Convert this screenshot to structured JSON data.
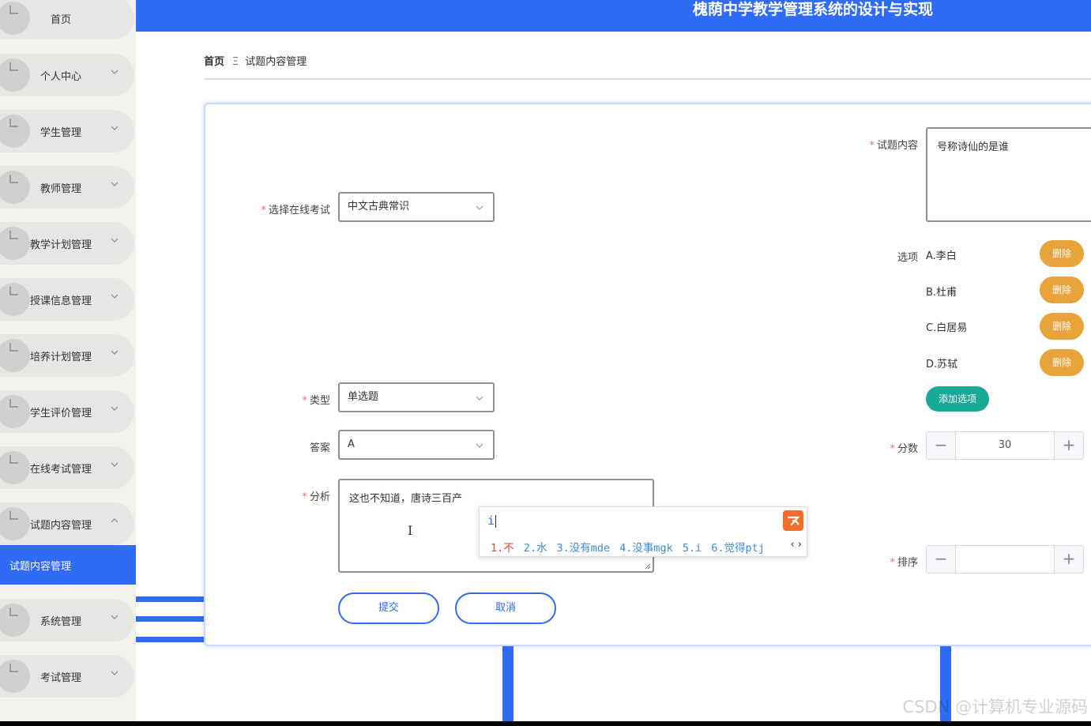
{
  "app": {
    "title": "槐荫中学教学管理系统的设计与实现"
  },
  "sidebar": {
    "items": [
      {
        "label": "首页",
        "has_chevron": false
      },
      {
        "label": "个人中心",
        "has_chevron": true
      },
      {
        "label": "学生管理",
        "has_chevron": true
      },
      {
        "label": "教师管理",
        "has_chevron": true
      },
      {
        "label": "教学计划管理",
        "has_chevron": true
      },
      {
        "label": "授课信息管理",
        "has_chevron": true
      },
      {
        "label": "培养计划管理",
        "has_chevron": true
      },
      {
        "label": "学生评价管理",
        "has_chevron": true
      },
      {
        "label": "在线考试管理",
        "has_chevron": true
      },
      {
        "label": "试题内容管理",
        "has_chevron": true,
        "expanded": true
      },
      {
        "label": "系统管理",
        "has_chevron": true
      },
      {
        "label": "考试管理",
        "has_chevron": true
      }
    ],
    "active_sub": "试题内容管理"
  },
  "breadcrumb": {
    "home": "首页",
    "separator": "Ξ",
    "current": "试题内容管理"
  },
  "form": {
    "exam_label": "选择在线考试",
    "exam_value": "中文古典常识",
    "type_label": "类型",
    "type_value": "单选题",
    "answer_label": "答案",
    "answer_value": "A",
    "analysis_label": "分析",
    "analysis_value": "这也不知道，唐诗三百产",
    "content_label": "试题内容",
    "content_value": "号称诗仙的是谁",
    "options_label": "选项",
    "options": [
      {
        "text": "A.李白",
        "delete_label": "删除"
      },
      {
        "text": "B.杜甫",
        "delete_label": "删除"
      },
      {
        "text": "C.白居易",
        "delete_label": "删除"
      },
      {
        "text": "D.苏轼",
        "delete_label": "删除"
      }
    ],
    "add_option_label": "添加选项",
    "score_label": "分数",
    "score_value": "30",
    "order_label": "排序",
    "order_value": "",
    "minus_symbol": "−",
    "plus_symbol": "+",
    "submit_label": "提交",
    "cancel_label": "取消"
  },
  "ime": {
    "composition": "i",
    "candidates": [
      "1.不",
      "2.水",
      "3.没有mde",
      "4.没事mgk",
      "5.i",
      "6.觉得ptj"
    ],
    "nav": "‹ ›"
  },
  "watermark": "CSDN @计算机专业源码",
  "colors": {
    "primary": "#2f6bf6",
    "delete": "#e9a33b",
    "add": "#19a996",
    "required": "#f56c6c"
  }
}
